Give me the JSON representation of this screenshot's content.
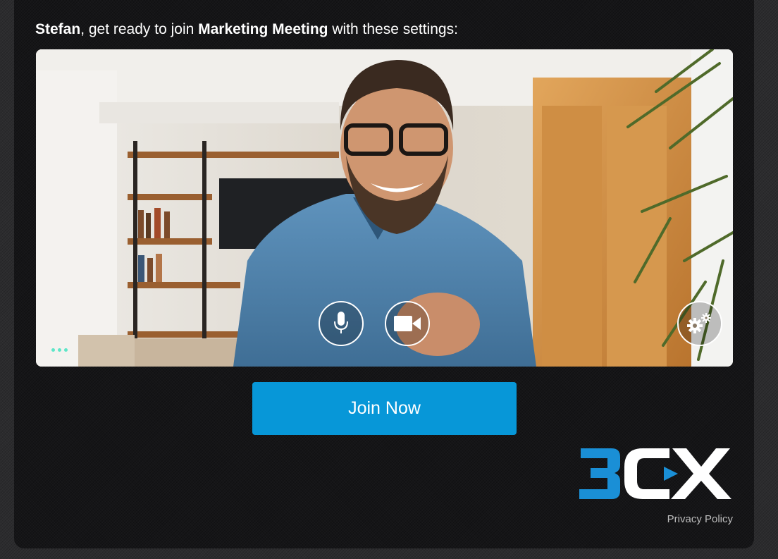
{
  "prejoin": {
    "user_name": "Stefan",
    "intro_text": ", get ready to join ",
    "meeting_name": "Marketing Meeting",
    "outro_text": " with these settings:"
  },
  "video_controls": {
    "microphone_icon": "microphone-icon",
    "camera_icon": "video-camera-icon",
    "settings_icon": "gears-icon",
    "more_icon": "more-dots-icon"
  },
  "join_button_label": "Join Now",
  "brand": {
    "logo_text": "3CX",
    "primary_color": "#0797d8",
    "logo_blue": "#1a8fd6"
  },
  "footer": {
    "privacy_policy_label": "Privacy Policy"
  }
}
